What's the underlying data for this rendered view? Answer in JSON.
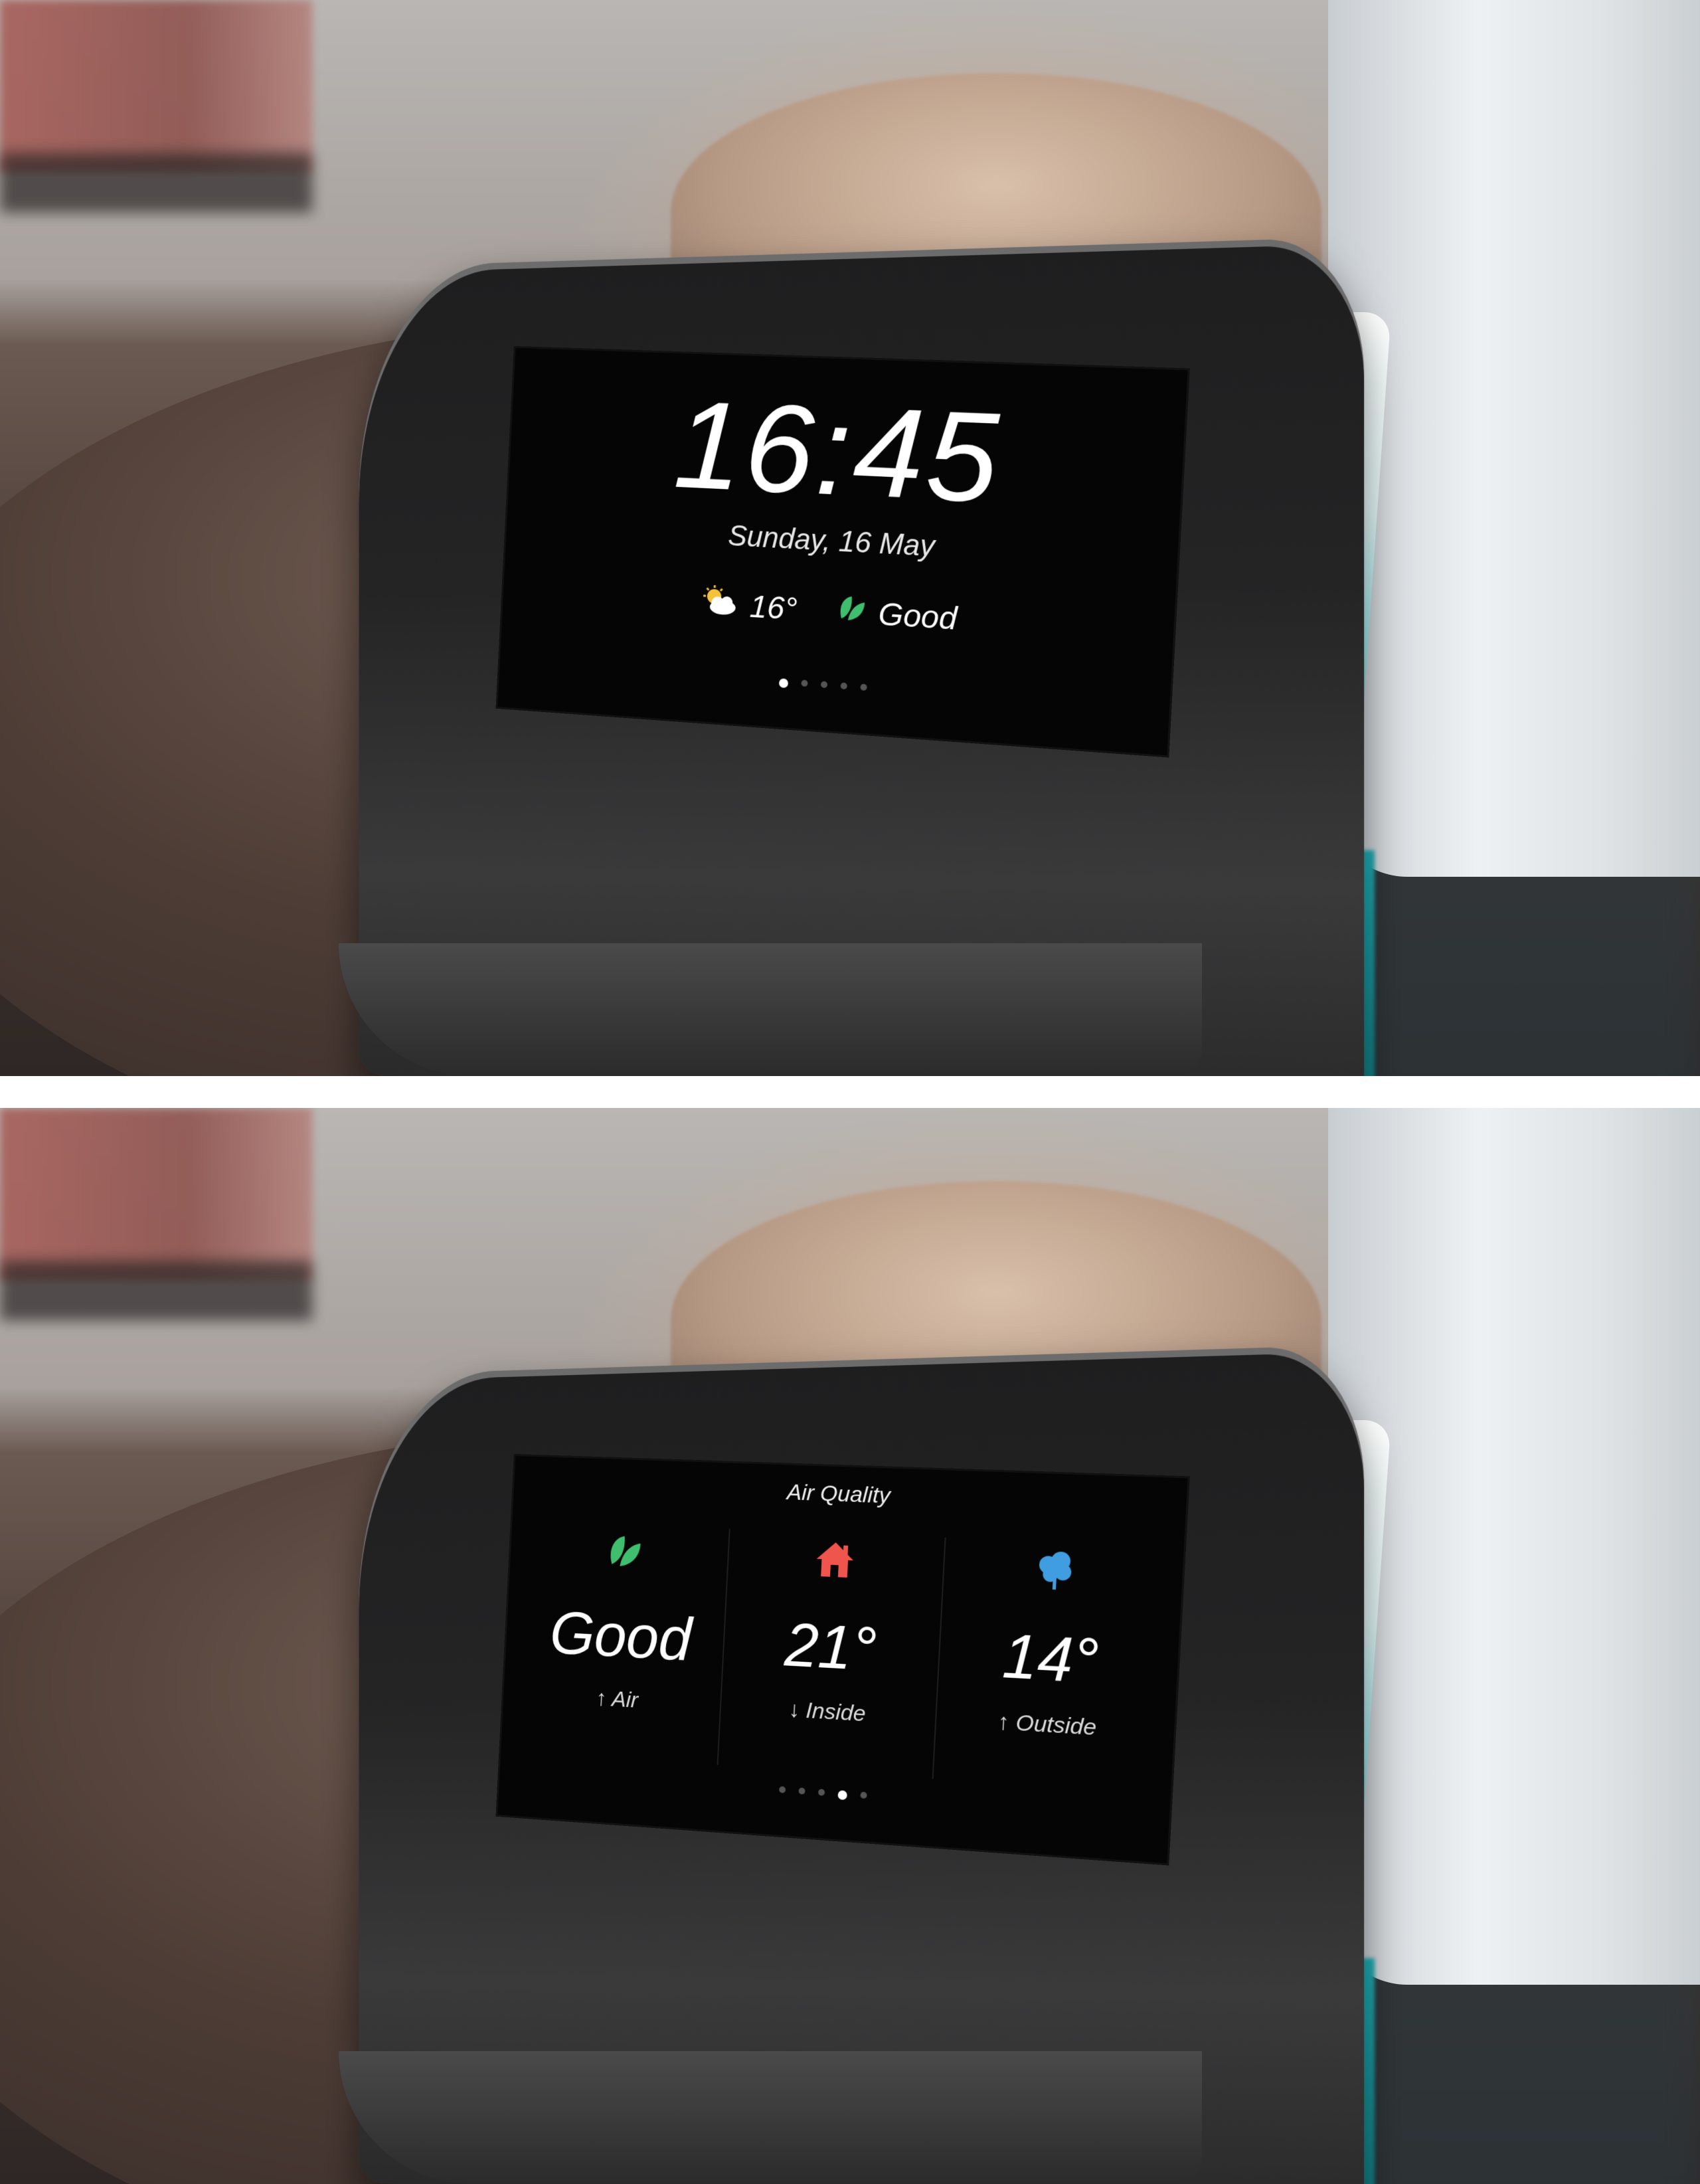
{
  "clock_screen": {
    "time": "16:45",
    "date": "Sunday, 16 May",
    "weather": {
      "icon": "partly-sunny-icon",
      "temperature": "16°"
    },
    "air": {
      "icon": "leaf-icon",
      "status": "Good"
    },
    "pager": {
      "total": 5,
      "active_index": 0
    }
  },
  "air_quality_screen": {
    "title": "Air Quality",
    "columns": [
      {
        "icon": "leaf-icon",
        "value": "Good",
        "label": "↑ Air"
      },
      {
        "icon": "house-icon",
        "value": "21°",
        "label": "↓ Inside"
      },
      {
        "icon": "tree-icon",
        "value": "14°",
        "label": "↑ Outside"
      }
    ],
    "pager": {
      "total": 5,
      "active_index": 3
    }
  },
  "colors": {
    "leaf_green": "#3fbf6e",
    "house_red": "#f0554d",
    "tree_blue": "#3f9de0",
    "sun_yellow": "#f5c23a",
    "device_accent_cyan": "#2ec9cf"
  }
}
